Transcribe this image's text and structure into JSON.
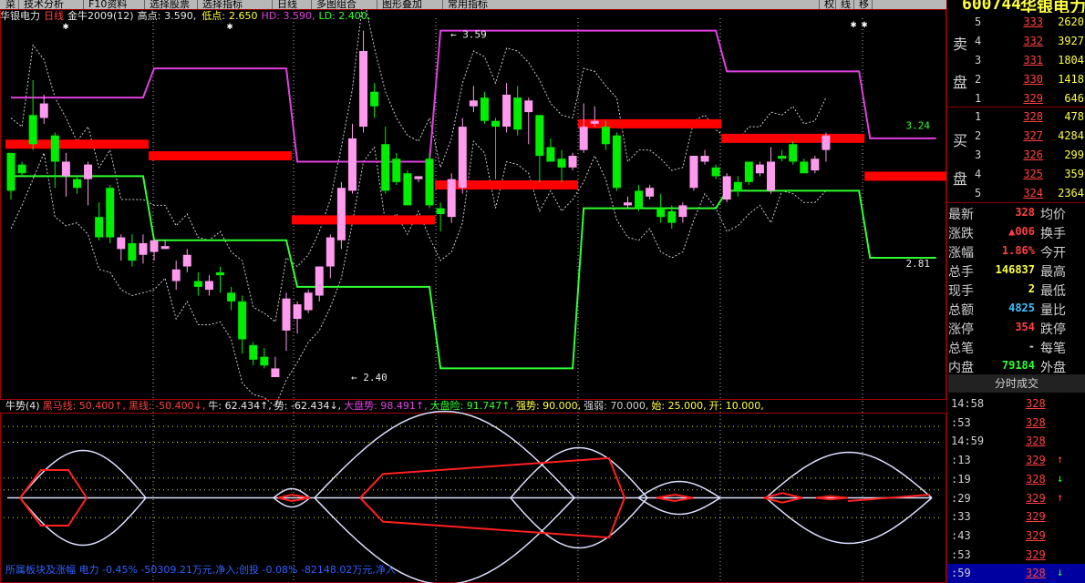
{
  "colors": {
    "bull": "#ff9aee",
    "bear": "#00ee00",
    "resistance": "#ff0000",
    "upper_channel": "#e040e0",
    "lower_channel": "#30ff30",
    "dotted": "#ffffff"
  },
  "menubar": {
    "items": [
      "菜",
      "技术分析",
      "F10资料",
      "选择股票",
      "选择指标",
      "日线",
      "多图组合",
      "图形叠加",
      "常用指标",
      "权",
      "线",
      "移"
    ]
  },
  "infobar": {
    "stock": "华银电力",
    "period": "日线",
    "indicator": "金牛2009(12)",
    "high_label": "高点:",
    "high_value": "3.590,",
    "low_label": "低点:",
    "low_value": "2.650",
    "hd": "HD: 3.590,",
    "ld": "LD: 2.400,"
  },
  "chart_labels": {
    "top_value": "3.59",
    "bottom_value": "2.40",
    "right_upper": "3.24",
    "right_lower": "2.81"
  },
  "indicator_info": {
    "name": "牛势(4)",
    "items": [
      "黑马线: 50.400↑,",
      "黑线: -50.400↓,",
      "牛: 62.434↑,",
      "势: -62.434↓,",
      "大盘势: 98.491↑,",
      "大盘险: 91.747↑,",
      "强势: 90.000,",
      "强弱: 70.000,",
      "始: 25.000,",
      "开: 10.000,"
    ]
  },
  "bottom_status": "所属板块及涨幅 电力 -0.45% -50309.21万元,净入;创投 -0.08% -82148.02万元,净入",
  "header": {
    "code": "600744",
    "name": "华银电力"
  },
  "orderbook": {
    "sell_label": [
      "卖",
      "盘"
    ],
    "buy_label": [
      "买",
      "盘"
    ],
    "sell": [
      {
        "lvl": "5",
        "price": "333",
        "vol": "2620"
      },
      {
        "lvl": "4",
        "price": "332",
        "vol": "3927"
      },
      {
        "lvl": "3",
        "price": "331",
        "vol": "1804"
      },
      {
        "lvl": "2",
        "price": "330",
        "vol": "1418"
      },
      {
        "lvl": "1",
        "price": "329",
        "vol": "646"
      }
    ],
    "buy": [
      {
        "lvl": "1",
        "price": "328",
        "vol": "478"
      },
      {
        "lvl": "2",
        "price": "327",
        "vol": "4284"
      },
      {
        "lvl": "3",
        "price": "326",
        "vol": "299"
      },
      {
        "lvl": "4",
        "price": "325",
        "vol": "359"
      },
      {
        "lvl": "5",
        "price": "324",
        "vol": "2364"
      }
    ]
  },
  "stats": [
    {
      "label": "最新",
      "value": "328",
      "color": "#ff4040",
      "label2": "均价"
    },
    {
      "label": "涨跌",
      "value": "▲006",
      "color": "#ff4040",
      "label2": "换手"
    },
    {
      "label": "涨幅",
      "value": "1.86%",
      "color": "#ff4040",
      "label2": "今开"
    },
    {
      "label": "总手",
      "value": "146837",
      "color": "#ffff40",
      "label2": "最高"
    },
    {
      "label": "现手",
      "value": "2",
      "color": "#ffff40",
      "label2": "最低"
    },
    {
      "label": "总额",
      "value": "4825",
      "color": "#40c0ff",
      "label2": "量比"
    },
    {
      "label": "涨停",
      "value": "354",
      "color": "#ff4040",
      "label2": "跌停"
    },
    {
      "label": "总笔",
      "value": "-",
      "color": "#d0d0d0",
      "label2": "每笔"
    },
    {
      "label": "内盘",
      "value": "79184",
      "color": "#30ff30",
      "label2": "外盘"
    }
  ],
  "trades_title": "分时成交",
  "trades": [
    {
      "time": "14:58",
      "price": "328",
      "arrow": "",
      "sel": false
    },
    {
      "time": ":53",
      "price": "328",
      "arrow": "",
      "sel": false
    },
    {
      "time": "14:59",
      "price": "328",
      "arrow": "",
      "sel": false
    },
    {
      "time": ":13",
      "price": "329",
      "arrow": "↑",
      "sel": false
    },
    {
      "time": ":19",
      "price": "328",
      "arrow": "↓",
      "sel": false
    },
    {
      "time": ":29",
      "price": "329",
      "arrow": "↑",
      "sel": false
    },
    {
      "time": ":33",
      "price": "329",
      "arrow": "",
      "sel": false
    },
    {
      "time": ":43",
      "price": "329",
      "arrow": "",
      "sel": false
    },
    {
      "time": ":53",
      "price": "329",
      "arrow": "",
      "sel": false
    },
    {
      "time": ":59",
      "price": "328",
      "arrow": "↓",
      "sel": true
    }
  ],
  "chart_data": {
    "type": "candlestick",
    "ylim": [
      2.35,
      3.62
    ],
    "high_marker": 3.59,
    "low_marker": 2.4,
    "candles": [
      {
        "o": 3.17,
        "c": 3.04,
        "h": 3.17,
        "l": 3.01
      },
      {
        "o": 3.13,
        "c": 3.1,
        "h": 3.14,
        "l": 3.09
      },
      {
        "o": 3.3,
        "c": 3.2,
        "h": 3.42,
        "l": 3.18
      },
      {
        "o": 3.29,
        "c": 3.34,
        "h": 3.37,
        "l": 3.27
      },
      {
        "o": 3.23,
        "c": 3.14,
        "h": 3.24,
        "l": 3.05
      },
      {
        "o": 3.09,
        "c": 3.14,
        "h": 3.17,
        "l": 3.02
      },
      {
        "o": 3.08,
        "c": 3.05,
        "h": 3.09,
        "l": 3.03
      },
      {
        "o": 3.08,
        "c": 3.13,
        "h": 3.14,
        "l": 2.99
      },
      {
        "o": 2.95,
        "c": 2.88,
        "h": 3.0,
        "l": 2.87
      },
      {
        "o": 3.05,
        "c": 2.88,
        "h": 3.06,
        "l": 2.86
      },
      {
        "o": 2.84,
        "c": 2.88,
        "h": 2.89,
        "l": 2.8
      },
      {
        "o": 2.86,
        "c": 2.8,
        "h": 2.89,
        "l": 2.78
      },
      {
        "o": 2.82,
        "c": 2.86,
        "h": 2.89,
        "l": 2.79
      },
      {
        "o": 2.83,
        "c": 2.87,
        "h": 2.87,
        "l": 2.8
      },
      {
        "o": 2.84,
        "c": 2.85,
        "h": 2.87,
        "l": 2.84
      },
      {
        "o": 2.73,
        "c": 2.77,
        "h": 2.8,
        "l": 2.7
      },
      {
        "o": 2.78,
        "c": 2.82,
        "h": 2.84,
        "l": 2.76
      },
      {
        "o": 2.73,
        "c": 2.71,
        "h": 2.76,
        "l": 2.68
      },
      {
        "o": 2.7,
        "c": 2.73,
        "h": 2.75,
        "l": 2.68
      },
      {
        "o": 2.76,
        "c": 2.75,
        "h": 2.78,
        "l": 2.69
      },
      {
        "o": 2.69,
        "c": 2.66,
        "h": 2.71,
        "l": 2.63
      },
      {
        "o": 2.66,
        "c": 2.53,
        "h": 2.68,
        "l": 2.48
      },
      {
        "o": 2.51,
        "c": 2.46,
        "h": 2.52,
        "l": 2.44
      },
      {
        "o": 2.47,
        "c": 2.44,
        "h": 2.5,
        "l": 2.43
      },
      {
        "o": 2.4,
        "c": 2.43,
        "h": 2.47,
        "l": 2.4
      },
      {
        "o": 2.56,
        "c": 2.67,
        "h": 2.69,
        "l": 2.49
      },
      {
        "o": 2.6,
        "c": 2.65,
        "h": 2.66,
        "l": 2.55
      },
      {
        "o": 2.63,
        "c": 2.69,
        "h": 2.7,
        "l": 2.62
      },
      {
        "o": 2.68,
        "c": 2.78,
        "h": 2.78,
        "l": 2.66
      },
      {
        "o": 2.78,
        "c": 2.88,
        "h": 2.89,
        "l": 2.74
      },
      {
        "o": 2.87,
        "c": 3.05,
        "h": 3.07,
        "l": 2.84
      },
      {
        "o": 3.04,
        "c": 3.22,
        "h": 3.27,
        "l": 3.03
      },
      {
        "o": 3.26,
        "c": 3.52,
        "h": 3.59,
        "l": 3.24
      },
      {
        "o": 3.38,
        "c": 3.33,
        "h": 3.41,
        "l": 3.29
      },
      {
        "o": 3.2,
        "c": 3.04,
        "h": 3.26,
        "l": 3.03
      },
      {
        "o": 3.15,
        "c": 3.07,
        "h": 3.17,
        "l": 3.06
      },
      {
        "o": 3.1,
        "c": 2.99,
        "h": 3.11,
        "l": 2.99
      },
      {
        "o": 3.08,
        "c": 3.09,
        "h": 3.09,
        "l": 3.07
      },
      {
        "o": 3.15,
        "c": 2.99,
        "h": 3.17,
        "l": 2.98
      },
      {
        "o": 2.98,
        "c": 2.96,
        "h": 3.0,
        "l": 2.9
      },
      {
        "o": 2.95,
        "c": 3.08,
        "h": 3.1,
        "l": 2.93
      },
      {
        "o": 3.05,
        "c": 3.26,
        "h": 3.29,
        "l": 3.03
      },
      {
        "o": 3.33,
        "c": 3.35,
        "h": 3.4,
        "l": 3.31
      },
      {
        "o": 3.36,
        "c": 3.28,
        "h": 3.38,
        "l": 3.27
      },
      {
        "o": 3.28,
        "c": 3.26,
        "h": 3.29,
        "l": 3.08
      },
      {
        "o": 3.26,
        "c": 3.37,
        "h": 3.41,
        "l": 3.24
      },
      {
        "o": 3.36,
        "c": 3.25,
        "h": 3.4,
        "l": 3.23
      },
      {
        "o": 3.31,
        "c": 3.35,
        "h": 3.36,
        "l": 3.2
      },
      {
        "o": 3.3,
        "c": 3.16,
        "h": 3.3,
        "l": 3.07
      },
      {
        "o": 3.19,
        "c": 3.14,
        "h": 3.22,
        "l": 3.14
      },
      {
        "o": 3.15,
        "c": 3.12,
        "h": 3.18,
        "l": 3.07
      },
      {
        "o": 3.12,
        "c": 3.16,
        "h": 3.17,
        "l": 3.11
      },
      {
        "o": 3.18,
        "c": 3.26,
        "h": 3.34,
        "l": 3.17
      },
      {
        "o": 3.27,
        "c": 3.28,
        "h": 3.33,
        "l": 3.26
      },
      {
        "o": 3.26,
        "c": 3.2,
        "h": 3.28,
        "l": 3.18
      },
      {
        "o": 3.23,
        "c": 3.05,
        "h": 3.24,
        "l": 3.04
      },
      {
        "o": 2.99,
        "c": 3.0,
        "h": 3.02,
        "l": 2.98
      },
      {
        "o": 3.04,
        "c": 2.98,
        "h": 3.06,
        "l": 2.97
      },
      {
        "o": 3.02,
        "c": 3.05,
        "h": 3.06,
        "l": 3.01
      },
      {
        "o": 2.98,
        "c": 2.95,
        "h": 3.03,
        "l": 2.93
      },
      {
        "o": 2.97,
        "c": 2.93,
        "h": 2.99,
        "l": 2.91
      },
      {
        "o": 2.95,
        "c": 2.99,
        "h": 3.0,
        "l": 2.93
      },
      {
        "o": 3.05,
        "c": 3.16,
        "h": 3.16,
        "l": 3.04
      },
      {
        "o": 3.14,
        "c": 3.16,
        "h": 3.18,
        "l": 3.13
      },
      {
        "o": 3.12,
        "c": 3.09,
        "h": 3.13,
        "l": 3.08
      },
      {
        "o": 3.01,
        "c": 3.09,
        "h": 3.1,
        "l": 3.0
      },
      {
        "o": 3.07,
        "c": 3.04,
        "h": 3.09,
        "l": 3.02
      },
      {
        "o": 3.14,
        "c": 3.07,
        "h": 3.14,
        "l": 3.06
      },
      {
        "o": 3.1,
        "c": 3.13,
        "h": 3.14,
        "l": 3.09
      },
      {
        "o": 3.04,
        "c": 3.14,
        "h": 3.19,
        "l": 3.03
      },
      {
        "o": 3.16,
        "c": 3.15,
        "h": 3.18,
        "l": 3.14
      },
      {
        "o": 3.2,
        "c": 3.14,
        "h": 3.21,
        "l": 3.13
      },
      {
        "o": 3.14,
        "c": 3.1,
        "h": 3.15,
        "l": 3.1
      },
      {
        "o": 3.11,
        "c": 3.15,
        "h": 3.16,
        "l": 3.1
      },
      {
        "o": 3.18,
        "c": 3.23,
        "h": 3.24,
        "l": 3.14
      }
    ],
    "resistance": [
      [
        0,
        12,
        3.2
      ],
      [
        13,
        25,
        3.16
      ],
      [
        26,
        38,
        2.94
      ],
      [
        39,
        51,
        3.06
      ],
      [
        52,
        64,
        3.27
      ],
      [
        65,
        77,
        3.22
      ],
      [
        78,
        85,
        3.09
      ]
    ],
    "upper_channel": [
      [
        0,
        3.36
      ],
      [
        12,
        3.36
      ],
      [
        13,
        3.46
      ],
      [
        25,
        3.46
      ],
      [
        26,
        3.14
      ],
      [
        38,
        3.14
      ],
      [
        39,
        3.59
      ],
      [
        64,
        3.59
      ],
      [
        65,
        3.45
      ],
      [
        77,
        3.45
      ],
      [
        78,
        3.22
      ],
      [
        84,
        3.22
      ]
    ],
    "lower_channel": [
      [
        0,
        3.09
      ],
      [
        12,
        3.09
      ],
      [
        13,
        2.87
      ],
      [
        25,
        2.87
      ],
      [
        26,
        2.71
      ],
      [
        38,
        2.71
      ],
      [
        39,
        2.43
      ],
      [
        51,
        2.43
      ],
      [
        52,
        2.98
      ],
      [
        64,
        2.98
      ],
      [
        65,
        3.04
      ],
      [
        77,
        3.04
      ],
      [
        78,
        2.81
      ],
      [
        84,
        2.81
      ]
    ],
    "right_upper_label": 3.24,
    "right_lower_label": 2.81,
    "indicator": {
      "name": "牛势(4)",
      "levels": [
        -50.4,
        50.4,
        62.434,
        -62.434,
        98.491,
        91.747,
        90,
        70,
        25,
        10
      ],
      "ylim": [
        -105,
        105
      ]
    }
  }
}
